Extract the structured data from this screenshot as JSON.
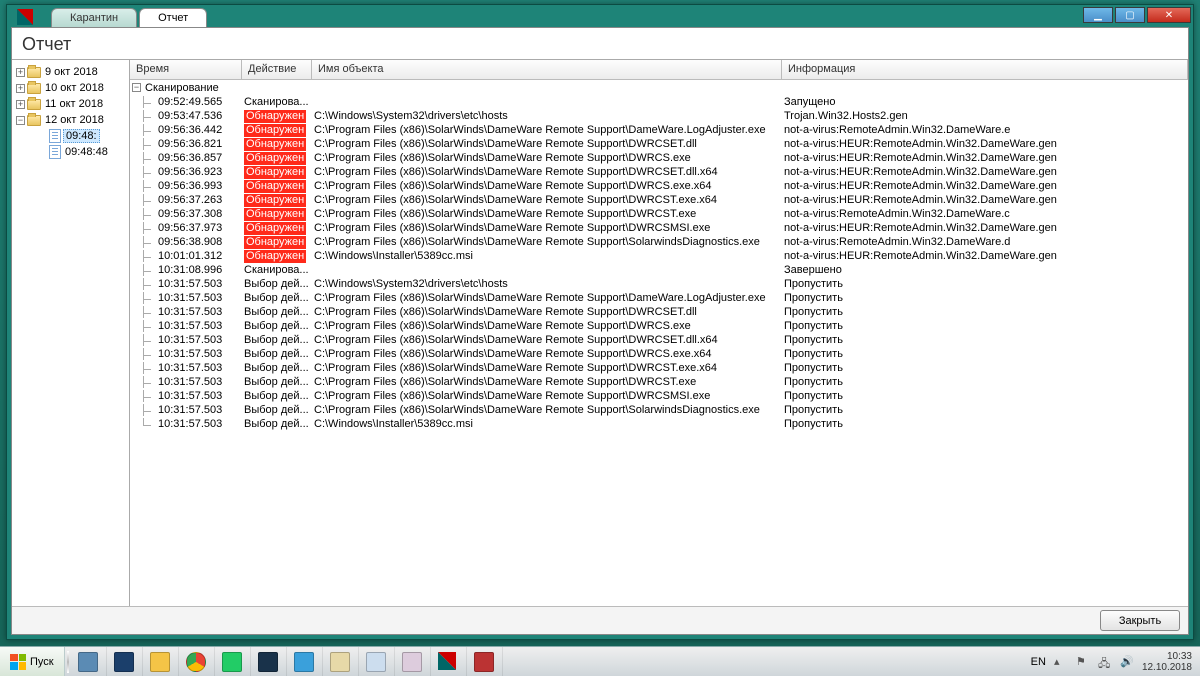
{
  "window": {
    "tabs": [
      {
        "label": "Карантин",
        "active": false
      },
      {
        "label": "Отчет",
        "active": true
      }
    ],
    "title": "Отчет",
    "footer_button": "Закрыть"
  },
  "tree": [
    {
      "type": "folder",
      "expandable": true,
      "expanded": false,
      "label": "9 окт 2018",
      "depth": 0
    },
    {
      "type": "folder",
      "expandable": true,
      "expanded": false,
      "label": "10 окт 2018",
      "depth": 0
    },
    {
      "type": "folder",
      "expandable": true,
      "expanded": false,
      "label": "11 окт 2018",
      "depth": 0
    },
    {
      "type": "folder",
      "expandable": true,
      "expanded": true,
      "label": "12 окт 2018",
      "depth": 0
    },
    {
      "type": "file",
      "expandable": false,
      "label": "09:48:",
      "depth": 1,
      "selected": true
    },
    {
      "type": "file",
      "expandable": false,
      "label": "09:48:48",
      "depth": 1
    }
  ],
  "grid": {
    "headers": {
      "time": "Время",
      "action": "Действие",
      "object": "Имя объекта",
      "info": "Информация"
    },
    "group_label": "Сканирование",
    "rows": [
      {
        "time": "09:52:49.565",
        "action": "Сканирова...",
        "object": "",
        "info": "Запущено"
      },
      {
        "time": "09:53:47.536",
        "action": "Обнаружен",
        "action_red": true,
        "object": "C:\\Windows\\System32\\drivers\\etc\\hosts",
        "info": "Trojan.Win32.Hosts2.gen"
      },
      {
        "time": "09:56:36.442",
        "action": "Обнаружен",
        "action_red": true,
        "object": "C:\\Program Files (x86)\\SolarWinds\\DameWare Remote Support\\DameWare.LogAdjuster.exe",
        "info": "not-a-virus:RemoteAdmin.Win32.DameWare.e"
      },
      {
        "time": "09:56:36.821",
        "action": "Обнаружен",
        "action_red": true,
        "object": "C:\\Program Files (x86)\\SolarWinds\\DameWare Remote Support\\DWRCSET.dll",
        "info": "not-a-virus:HEUR:RemoteAdmin.Win32.DameWare.gen"
      },
      {
        "time": "09:56:36.857",
        "action": "Обнаружен",
        "action_red": true,
        "object": "C:\\Program Files (x86)\\SolarWinds\\DameWare Remote Support\\DWRCS.exe",
        "info": "not-a-virus:HEUR:RemoteAdmin.Win32.DameWare.gen"
      },
      {
        "time": "09:56:36.923",
        "action": "Обнаружен",
        "action_red": true,
        "object": "C:\\Program Files (x86)\\SolarWinds\\DameWare Remote Support\\DWRCSET.dll.x64",
        "info": "not-a-virus:HEUR:RemoteAdmin.Win32.DameWare.gen"
      },
      {
        "time": "09:56:36.993",
        "action": "Обнаружен",
        "action_red": true,
        "object": "C:\\Program Files (x86)\\SolarWinds\\DameWare Remote Support\\DWRCS.exe.x64",
        "info": "not-a-virus:HEUR:RemoteAdmin.Win32.DameWare.gen"
      },
      {
        "time": "09:56:37.263",
        "action": "Обнаружен",
        "action_red": true,
        "object": "C:\\Program Files (x86)\\SolarWinds\\DameWare Remote Support\\DWRCST.exe.x64",
        "info": "not-a-virus:HEUR:RemoteAdmin.Win32.DameWare.gen"
      },
      {
        "time": "09:56:37.308",
        "action": "Обнаружен",
        "action_red": true,
        "object": "C:\\Program Files (x86)\\SolarWinds\\DameWare Remote Support\\DWRCST.exe",
        "info": "not-a-virus:RemoteAdmin.Win32.DameWare.c"
      },
      {
        "time": "09:56:37.973",
        "action": "Обнаружен",
        "action_red": true,
        "object": "C:\\Program Files (x86)\\SolarWinds\\DameWare Remote Support\\DWRCSMSI.exe",
        "info": "not-a-virus:HEUR:RemoteAdmin.Win32.DameWare.gen"
      },
      {
        "time": "09:56:38.908",
        "action": "Обнаружен",
        "action_red": true,
        "object": "C:\\Program Files (x86)\\SolarWinds\\DameWare Remote Support\\SolarwindsDiagnostics.exe",
        "info": "not-a-virus:RemoteAdmin.Win32.DameWare.d"
      },
      {
        "time": "10:01:01.312",
        "action": "Обнаружен",
        "action_red": true,
        "object": "C:\\Windows\\Installer\\5389cc.msi",
        "info": "not-a-virus:HEUR:RemoteAdmin.Win32.DameWare.gen"
      },
      {
        "time": "10:31:08.996",
        "action": "Сканирова...",
        "object": "",
        "info": "Завершено"
      },
      {
        "time": "10:31:57.503",
        "action": "Выбор дей...",
        "object": "C:\\Windows\\System32\\drivers\\etc\\hosts",
        "info": "Пропустить"
      },
      {
        "time": "10:31:57.503",
        "action": "Выбор дей...",
        "object": "C:\\Program Files (x86)\\SolarWinds\\DameWare Remote Support\\DameWare.LogAdjuster.exe",
        "info": "Пропустить"
      },
      {
        "time": "10:31:57.503",
        "action": "Выбор дей...",
        "object": "C:\\Program Files (x86)\\SolarWinds\\DameWare Remote Support\\DWRCSET.dll",
        "info": "Пропустить"
      },
      {
        "time": "10:31:57.503",
        "action": "Выбор дей...",
        "object": "C:\\Program Files (x86)\\SolarWinds\\DameWare Remote Support\\DWRCS.exe",
        "info": "Пропустить"
      },
      {
        "time": "10:31:57.503",
        "action": "Выбор дей...",
        "object": "C:\\Program Files (x86)\\SolarWinds\\DameWare Remote Support\\DWRCSET.dll.x64",
        "info": "Пропустить"
      },
      {
        "time": "10:31:57.503",
        "action": "Выбор дей...",
        "object": "C:\\Program Files (x86)\\SolarWinds\\DameWare Remote Support\\DWRCS.exe.x64",
        "info": "Пропустить"
      },
      {
        "time": "10:31:57.503",
        "action": "Выбор дей...",
        "object": "C:\\Program Files (x86)\\SolarWinds\\DameWare Remote Support\\DWRCST.exe.x64",
        "info": "Пропустить"
      },
      {
        "time": "10:31:57.503",
        "action": "Выбор дей...",
        "object": "C:\\Program Files (x86)\\SolarWinds\\DameWare Remote Support\\DWRCST.exe",
        "info": "Пропустить"
      },
      {
        "time": "10:31:57.503",
        "action": "Выбор дей...",
        "object": "C:\\Program Files (x86)\\SolarWinds\\DameWare Remote Support\\DWRCSMSI.exe",
        "info": "Пропустить"
      },
      {
        "time": "10:31:57.503",
        "action": "Выбор дей...",
        "object": "C:\\Program Files (x86)\\SolarWinds\\DameWare Remote Support\\SolarwindsDiagnostics.exe",
        "info": "Пропустить"
      },
      {
        "time": "10:31:57.503",
        "action": "Выбор дей...",
        "object": "C:\\Windows\\Installer\\5389cc.msi",
        "info": "Пропустить"
      }
    ]
  },
  "taskbar": {
    "start_label": "Пуск",
    "lang": "EN",
    "clock_time": "10:33",
    "clock_date": "12.10.2018",
    "apps": [
      "server-manager",
      "powershell",
      "explorer",
      "chrome",
      "remote-desktop",
      "task-manager",
      "internet-explorer",
      "paint",
      "notepad",
      "kaspersky-tool",
      "kaspersky-av",
      "toolbox"
    ]
  }
}
